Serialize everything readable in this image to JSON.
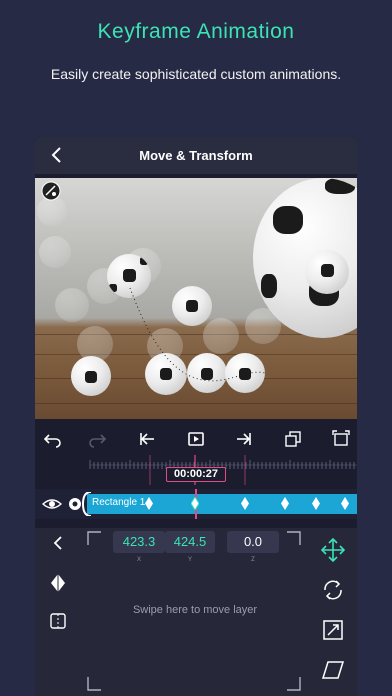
{
  "promo": {
    "title": "Keyframe Animation",
    "subtitle": "Easily create sophisticated custom animations."
  },
  "nav": {
    "title": "Move & Transform"
  },
  "timeline": {
    "timecode": "00:00:27",
    "layer_name": "Rectangle 1"
  },
  "transform": {
    "x_value": "423.3",
    "y_value": "424.5",
    "z_value": "0.0",
    "x_label": "X",
    "y_label": "Y",
    "z_label": "Z",
    "hint": "Swipe here to move layer"
  },
  "colors": {
    "background": "#262a45",
    "accent_green": "#3be3b5",
    "playhead_pink": "#e24c86",
    "layer_blue": "#1ba6d6"
  },
  "icons": [
    "back-icon",
    "undo-icon",
    "redo-icon",
    "jump-start-icon",
    "loop-icon",
    "jump-end-icon",
    "duplicate-icon",
    "fit-icon",
    "eye-icon",
    "gear-icon",
    "move-icon",
    "rotate-icon",
    "scale-icon",
    "skew-icon",
    "keyframe-icon",
    "mirror-icon"
  ]
}
